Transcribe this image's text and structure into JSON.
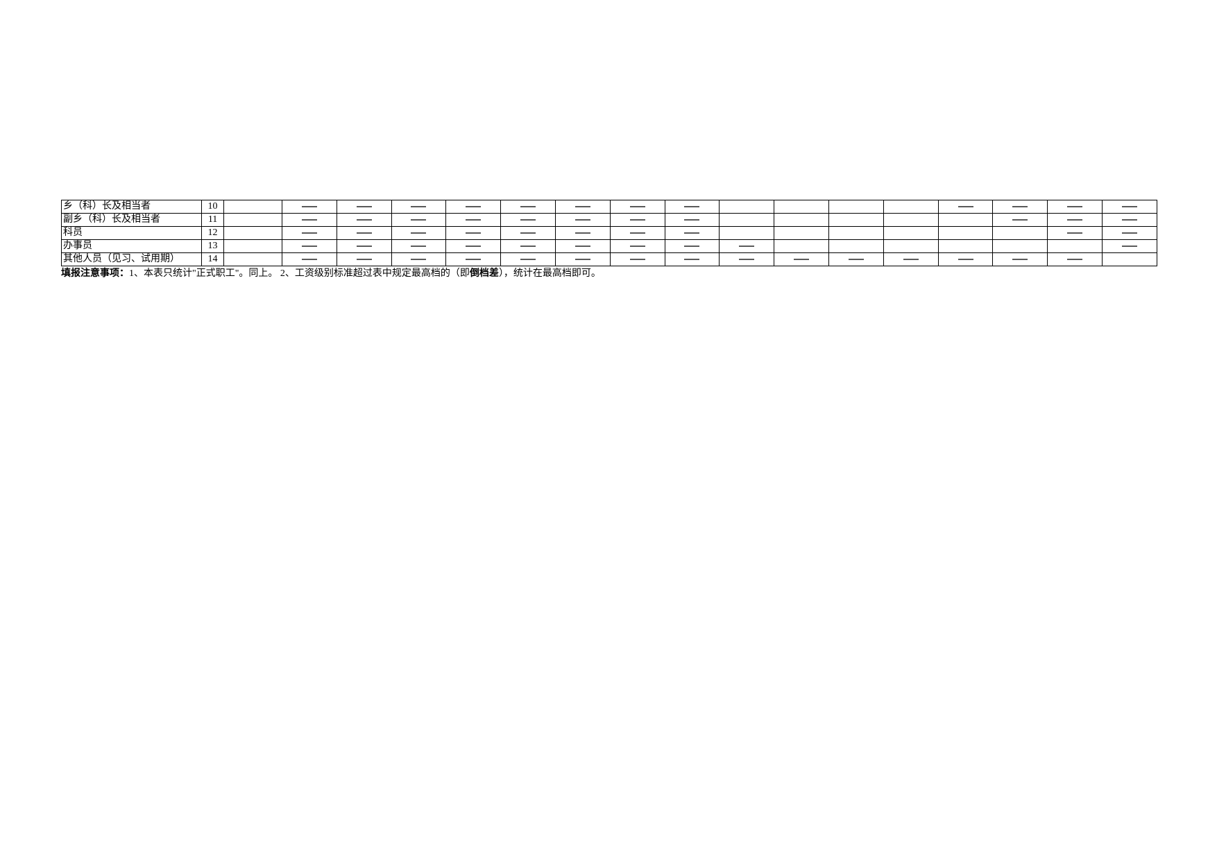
{
  "rows": [
    {
      "label": "乡（科）长及相当者",
      "num": "10",
      "cells": [
        "",
        "D",
        "D",
        "D",
        "D",
        "D",
        "D",
        "D",
        "D",
        "",
        "",
        "",
        "",
        "D",
        "D",
        "D",
        "D"
      ]
    },
    {
      "label": "副乡（科）长及相当者",
      "num": "11",
      "cells": [
        "",
        "D",
        "D",
        "D",
        "D",
        "D",
        "D",
        "D",
        "D",
        "",
        "",
        "",
        "",
        "",
        "D",
        "D",
        "D"
      ]
    },
    {
      "label": "科员",
      "num": "12",
      "cells": [
        "",
        "D",
        "D",
        "D",
        "D",
        "D",
        "D",
        "D",
        "D",
        "",
        "",
        "",
        "",
        "",
        "",
        "D",
        "D"
      ]
    },
    {
      "label": "办事员",
      "num": "13",
      "cells": [
        "",
        "D",
        "D",
        "D",
        "D",
        "D",
        "D",
        "D",
        "D",
        "D",
        "",
        "",
        "",
        "",
        "",
        "",
        "D"
      ]
    },
    {
      "label": "其他人员（见习、试用期）",
      "num": "14",
      "cells": [
        "",
        "D",
        "D",
        "D",
        "D",
        "D",
        "D",
        "D",
        "D",
        "D",
        "D",
        "D",
        "D",
        "D",
        "D",
        "D",
        ""
      ]
    }
  ],
  "note": {
    "prefix_bold": "填报注意事项：",
    "part1": "1、本表只统计\"正式职工\"。同上。   2、工资级别标准超过表中规定最高档的（即",
    "emph_bold": "倒档差",
    "part2": "），统计在最高档即可。"
  }
}
